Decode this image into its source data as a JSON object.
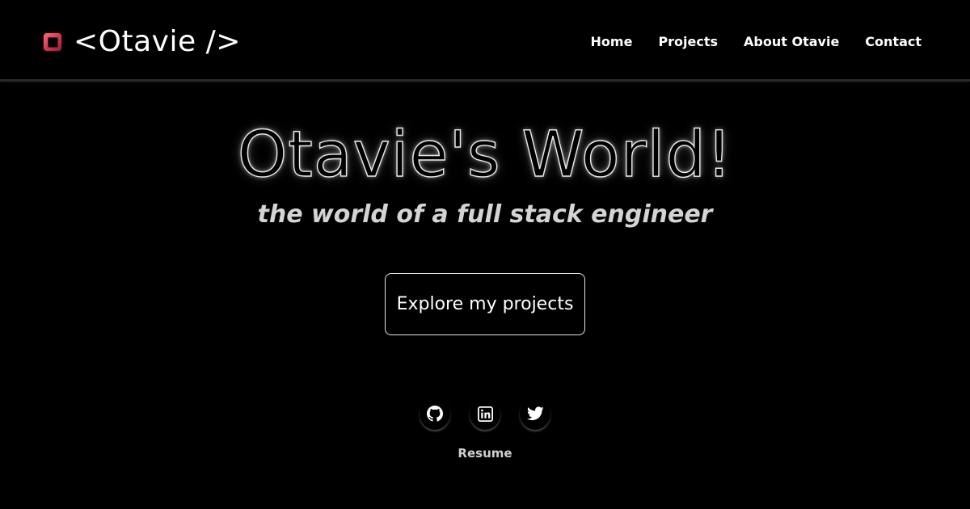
{
  "brand": {
    "logo_icon": "app-square-icon",
    "title": "<Otavie />",
    "accent_color": "#e0455c"
  },
  "nav": {
    "items": [
      {
        "label": "Home"
      },
      {
        "label": "Projects"
      },
      {
        "label": "About Otavie"
      },
      {
        "label": "Contact"
      }
    ]
  },
  "hero": {
    "title": "Otavie's World!",
    "subtitle": "the world of a full stack engineer",
    "cta_label": "Explore my projects"
  },
  "socials": [
    {
      "icon": "github-icon"
    },
    {
      "icon": "linkedin-icon"
    },
    {
      "icon": "twitter-icon"
    }
  ],
  "resume_label": "Resume",
  "colors": {
    "background": "#000000",
    "text": "#ffffff",
    "muted_text": "#d4d4d4"
  }
}
